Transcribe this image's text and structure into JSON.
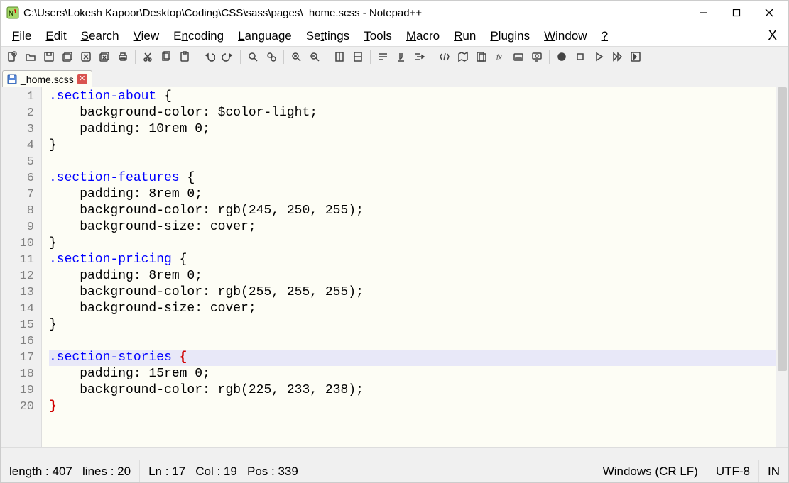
{
  "window": {
    "title": "C:\\Users\\Lokesh Kapoor\\Desktop\\Coding\\CSS\\sass\\pages\\_home.scss - Notepad++"
  },
  "menus": {
    "file": {
      "label": "File",
      "hotkey_index": 0
    },
    "edit": {
      "label": "Edit",
      "hotkey_index": 0
    },
    "search": {
      "label": "Search",
      "hotkey_index": 0
    },
    "view": {
      "label": "View",
      "hotkey_index": 0
    },
    "encoding": {
      "label": "Encoding",
      "hotkey_index": 1
    },
    "language": {
      "label": "Language",
      "hotkey_index": 0
    },
    "settings": {
      "label": "Settings",
      "hotkey_index": 2
    },
    "tools": {
      "label": "Tools",
      "hotkey_index": 0
    },
    "macro": {
      "label": "Macro",
      "hotkey_index": 0
    },
    "run": {
      "label": "Run",
      "hotkey_index": 0
    },
    "plugins": {
      "label": "Plugins",
      "hotkey_index": 0
    },
    "window": {
      "label": "Window",
      "hotkey_index": 0
    },
    "help": {
      "label": "?",
      "hotkey_index": 0
    }
  },
  "close_docs_x": "X",
  "tab": {
    "filename": "_home.scss"
  },
  "code": {
    "highlighted_line": 17,
    "lines": [
      {
        "n": 1,
        "text": ".section-about {"
      },
      {
        "n": 2,
        "text": "    background-color: $color-light;"
      },
      {
        "n": 3,
        "text": "    padding: 10rem 0;"
      },
      {
        "n": 4,
        "text": "}"
      },
      {
        "n": 5,
        "text": ""
      },
      {
        "n": 6,
        "text": ".section-features {"
      },
      {
        "n": 7,
        "text": "    padding: 8rem 0;"
      },
      {
        "n": 8,
        "text": "    background-color: rgb(245, 250, 255);"
      },
      {
        "n": 9,
        "text": "    background-size: cover;"
      },
      {
        "n": 10,
        "text": "}"
      },
      {
        "n": 11,
        "text": ".section-pricing {"
      },
      {
        "n": 12,
        "text": "    padding: 8rem 0;"
      },
      {
        "n": 13,
        "text": "    background-color: rgb(255, 255, 255);"
      },
      {
        "n": 14,
        "text": "    background-size: cover;"
      },
      {
        "n": 15,
        "text": "}"
      },
      {
        "n": 16,
        "text": ""
      },
      {
        "n": 17,
        "text": ".section-stories {"
      },
      {
        "n": 18,
        "text": "    padding: 15rem 0;"
      },
      {
        "n": 19,
        "text": "    background-color: rgb(225, 233, 238);"
      },
      {
        "n": 20,
        "text": "}"
      }
    ]
  },
  "status": {
    "length_label": "length : 407",
    "lines_label": "lines : 20",
    "ln_label": "Ln : 17",
    "col_label": "Col : 19",
    "pos_label": "Pos : 339",
    "eol": "Windows (CR LF)",
    "encoding": "UTF-8",
    "ins": "IN"
  }
}
